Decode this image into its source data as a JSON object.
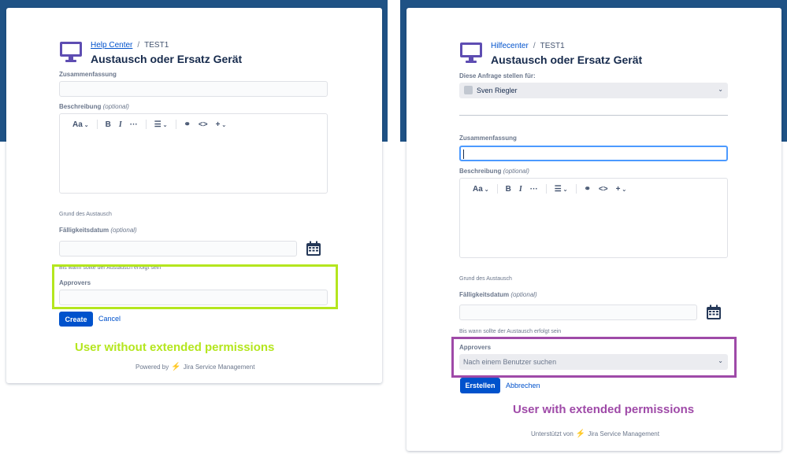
{
  "colors": {
    "header_band": "#1f5285",
    "primary_button": "#0052cc",
    "link": "#0052cc",
    "highlight_left": "#b4e61e",
    "highlight_right": "#9f4aa8",
    "icon": "#5e4db2"
  },
  "left": {
    "breadcrumb": {
      "home": "Help Center",
      "project": "TEST1"
    },
    "title": "Austausch oder Ersatz Gerät",
    "summary_label": "Zusammenfassung",
    "description_label": "Beschreibung",
    "description_optional": "(optional)",
    "toolbar": {
      "text_style": "Aa",
      "bold": "B",
      "italic": "I",
      "more": "···",
      "list": "☰",
      "link": "⚭",
      "code": "<>",
      "insert": "+"
    },
    "reason_label": "Grund des Austausch",
    "due_label": "Fälligkeitsdatum",
    "due_optional": "(optional)",
    "due_help": "Bis wann sollte der Austausch erfolgt sein",
    "approvers_label": "Approvers",
    "create_button": "Create",
    "cancel_link": "Cancel",
    "caption": "User without extended permissions",
    "powered_by": "Powered by",
    "powered_product": "Jira Service Management"
  },
  "right": {
    "breadcrumb": {
      "home": "Hilfecenter",
      "project": "TEST1"
    },
    "title": "Austausch oder Ersatz Gerät",
    "request_for_label": "Diese Anfrage stellen für:",
    "request_for_value": "Sven Riegler",
    "summary_label": "Zusammenfassung",
    "description_label": "Beschreibung",
    "description_optional": "(optional)",
    "toolbar": {
      "text_style": "Aa",
      "bold": "B",
      "italic": "I",
      "more": "···",
      "list": "☰",
      "link": "⚭",
      "code": "<>",
      "insert": "+"
    },
    "reason_label": "Grund des Austausch",
    "due_label": "Fälligkeitsdatum",
    "due_optional": "(optional)",
    "due_help": "Bis wann sollte der Austausch erfolgt sein",
    "approvers_label": "Approvers",
    "approvers_placeholder": "Nach einem Benutzer suchen",
    "create_button": "Erstellen",
    "cancel_link": "Abbrechen",
    "caption": "User with extended permissions",
    "powered_by": "Unterstützt von",
    "powered_product": "Jira Service Management"
  }
}
